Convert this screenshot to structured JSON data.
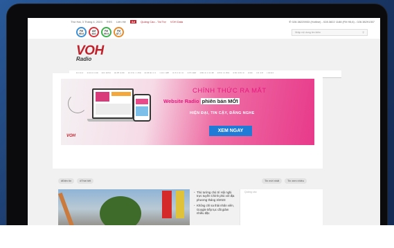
{
  "topbar": {
    "date": "Thứ Hai, 3 Tháng 4, 2023",
    "rss": "RSS",
    "contact": "Liên Hệ",
    "ad_badge": "Ad",
    "ad_text": "Quảng Cáo - Tài Trợ",
    "voh_data": "VOH Data",
    "hotline": "028.38225933 (Hotline) - 028.3822 1188 (FM 95,6) - 028.38291357"
  },
  "stations": [
    {
      "label": "FM\n95.6",
      "color": "#3a8fd6"
    },
    {
      "label": "AM\n610",
      "color": "#d6343a"
    },
    {
      "label": "FM\n99.9",
      "color": "#3ab04a"
    },
    {
      "label": "FM\n87.7",
      "color": "#e88a2a"
    }
  ],
  "search": {
    "placeholder": "Nhập nội dung tìm kiếm",
    "icon": "search-icon"
  },
  "logo": {
    "main": "VOH",
    "sub": "Radio"
  },
  "nav": {
    "items": [
      "RADIO",
      "PODCAST",
      "TIN TỨC",
      "THẾ GIỚI",
      "PHÁP LUẬT",
      "THỂ THAO",
      "KINH TẾ",
      "GIÁO DỤC",
      "GIẢI TRÍ",
      "CÔNG NGHỆ",
      "SỨC KHỎE",
      "ĐỜI SỐNG",
      "ĐẸP",
      "XỔ SỐ",
      "VIDEO"
    ]
  },
  "banner": {
    "title": "CHÍNH THỨC RA MẮT",
    "site_prefix": "Website Radio",
    "site_suffix": "phiên bản MỚI",
    "subtitle": "HIỆN ĐẠI, TIN CẬY, ĐĂNG NGHE",
    "cta": "XEM NGAY",
    "logo": "VOH"
  },
  "tags": [
    "#Điện tín",
    "#Thời tiết"
  ],
  "right_tabs": [
    "Tin mới nhất",
    "Tin xem nhiều"
  ],
  "news": [
    "Thủ tướng chủ trì Hội nghị trực tuyến Chính phủ với địa phương tháng 3/2023",
    "Không chỉ sa thải nhân viên, Google tiếp tục cắt giảm nhiều đặc"
  ],
  "side_label": "Quảng cáo"
}
